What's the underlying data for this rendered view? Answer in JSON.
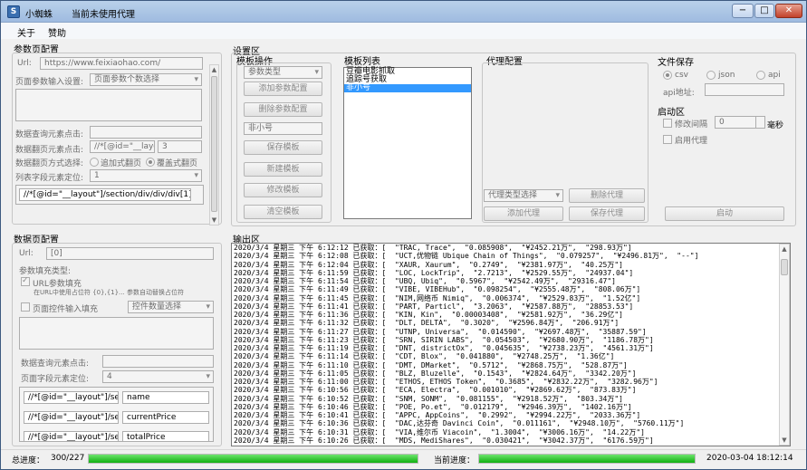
{
  "window": {
    "title": "小蜘蛛",
    "status": "当前未使用代理",
    "icon": "spider-app-icon",
    "controls": {
      "min": "−",
      "max": "□",
      "close": "✕"
    }
  },
  "menu": [
    {
      "label": "关于"
    },
    {
      "label": "赞助"
    }
  ],
  "param_config": {
    "title": "参数页配置",
    "url_label": "Url:",
    "url_value": "https://www.feixiaohao.com/",
    "page_param_label": "页面参数输入设置:",
    "page_param_select": "页面参数个数选择",
    "query_click_label": "数据查询元素点击:",
    "page_click_label": "数据翻页元素点击:",
    "page_click_value": "//*[@id=\"__layo",
    "page_click_count": "3",
    "page_mode_label": "数据翻页方式选择:",
    "page_mode_options": [
      "追加式翻页",
      "覆盖式翻页"
    ],
    "list_locate_label": "列表字段元素定位:",
    "list_locate_value": "1",
    "xpath_value": "//*[@id=\"__layout\"]/section/div/div/div[1]"
  },
  "data_config": {
    "title": "数据页配置",
    "url_label": "Url:",
    "url_value": "[0]",
    "param_type_label": "参数填充类型:",
    "url_fill_label": "URL参数填充",
    "url_fill_hint": "在URL中使用占位符 {0},{1}... 参数自动替换占位符",
    "ctrl_fill_label": "页面控件输入填充",
    "ctrl_count_select": "控件数量选择",
    "query_click_label": "数据查询元素点击:",
    "field_locate_label": "页面字段元素定位:",
    "field_locate_value": "4",
    "fields": [
      {
        "xpath": "//*[@id=\"__layout\"]/sec",
        "name": "name"
      },
      {
        "xpath": "//*[@id=\"__layout\"]/sec",
        "name": "currentPrice"
      },
      {
        "xpath": "//*[@id=\"__layout\"]/sec",
        "name": "totalPrice"
      }
    ]
  },
  "settings": {
    "title": "设置区",
    "template_ops": {
      "title": "模板操作",
      "param_type_select": "参数类型",
      "add_param": "添加参数配置",
      "delete_param": "删除参数配置",
      "template_name": "非小号",
      "save_template": "保存模板",
      "new_template": "新建模板",
      "edit_template": "修改模板",
      "clear_template": "清空模板"
    },
    "template_list": {
      "title": "模板列表",
      "items": [
        "豆瓣电影抓取",
        "追踪号获取",
        "非小号"
      ],
      "selected_index": 2
    },
    "proxy": {
      "title": "代理配置",
      "type_select": "代理类型选择",
      "delete_proxy": "删除代理",
      "add_proxy": "添加代理",
      "save_proxy": "保存代理"
    },
    "file_save": {
      "title": "文件保存",
      "options": [
        "csv",
        "json",
        "api"
      ],
      "api_label": "api地址:"
    },
    "start_area": {
      "title": "启动区",
      "interval_label": "修改间隔",
      "interval_value": "0",
      "interval_unit": "毫秒",
      "use_proxy_label": "启用代理",
      "start_button": "启动"
    }
  },
  "output": {
    "title": "输出区",
    "lines": [
      "2020/3/4 星期三 下午 6:12:12 已获取：[  \"TRAC, Trace\",  \"0.085908\",  \"¥2452.21万\",  \"298.93万\"]",
      "2020/3/4 星期三 下午 6:12:08 已获取：[  \"UCT,优物链 Ubique Chain of Things\",  \"0.079257\",  \"¥2496.81万\",  \"--\"]",
      "2020/3/4 星期三 下午 6:12:04 已获取：[  \"XAUR, Xaurum\",  \"0.2749\",  \"¥2381.97万\",  \"40.25万\"]",
      "2020/3/4 星期三 下午 6:11:59 已获取：[  \"LOC, LockTrip\",  \"2.7213\",  \"¥2529.55万\",  \"24937.04\"]",
      "2020/3/4 星期三 下午 6:11:54 已获取：[  \"UBQ, Ubiq\",  \"0.5967\",  \"¥2542.49万\",  \"29316.47\"]",
      "2020/3/4 星期三 下午 6:11:49 已获取：[  \"VIBE, VIBEHub\",  \"0.098254\",  \"¥2555.48万\",  \"808.06万\"]",
      "2020/3/4 星期三 下午 6:11:45 已获取：[  \"NIM,网络币 Nimiq\",  \"0.006374\",  \"¥2529.83万\",  \"1.52亿\"]",
      "2020/3/4 星期三 下午 6:11:41 已获取：[  \"PART, Particl\",  \"3.2063\",  \"¥2587.88万\",  \"28853.53\"]",
      "2020/3/4 星期三 下午 6:11:36 已获取：[  \"KIN, Kin\",  \"0.00003408\",  \"¥2581.92万\",  \"36.29亿\"]",
      "2020/3/4 星期三 下午 6:11:32 已获取：[  \"DLT, DELTA\",  \"0.3020\",  \"¥2596.84万\",  \"206.91万\"]",
      "2020/3/4 星期三 下午 6:11:27 已获取：[  \"UTNP, Universa\",  \"0.014590\",  \"¥2697.48万\",  \"35887.59\"]",
      "2020/3/4 星期三 下午 6:11:23 已获取：[  \"SRN, SIRIN LABS\",  \"0.054503\",  \"¥2680.90万\",  \"1186.78万\"]",
      "2020/3/4 星期三 下午 6:11:19 已获取：[  \"DNT, districtOx\",  \"0.045635\",  \"¥2738.23万\",  \"4561.31万\"]",
      "2020/3/4 星期三 下午 6:11:14 已获取：[  \"CDT, Blox\",  \"0.041880\",  \"¥2748.25万\",  \"1.36亿\"]",
      "2020/3/4 星期三 下午 6:11:10 已获取：[  \"DMT, DMarket\",  \"0.5712\",  \"¥2868.75万\",  \"528.87万\"]",
      "2020/3/4 星期三 下午 6:11:05 已获取：[  \"BLZ, Bluzelle\",  \"0.1543\",  \"¥2824.64万\",  \"3342.20万\"]",
      "2020/3/4 星期三 下午 6:11:00 已获取：[  \"ETHOS, ETHOS Token\",  \"0.3685\",  \"¥2832.22万\",  \"3282.96万\"]",
      "2020/3/4 星期三 下午 6:10:56 已获取：[  \"ECA, Electra\",  \"0.001010\",  \"¥2869.62万\",  \"873.83万\"]",
      "2020/3/4 星期三 下午 6:10:52 已获取：[  \"SNM, SONM\",  \"0.081155\",  \"¥2918.52万\",  \"803.34万\"]",
      "2020/3/4 星期三 下午 6:10:46 已获取：[  \"POE, Po.et\",  \"0.012179\",  \"¥2946.39万\",  \"1402.16万\"]",
      "2020/3/4 星期三 下午 6:10:41 已获取：[  \"APPC, AppCoins\",  \"0.2992\",  \"¥2994.22万\",  \"2033.36万\"]",
      "2020/3/4 星期三 下午 6:10:36 已获取：[  \"DAC,达芬奇 Davinci Coin\",  \"0.011161\",  \"¥2948.10万\",  \"5760.11万\"]",
      "2020/3/4 星期三 下午 6:10:31 已获取：[  \"VIA,维尔币 Viacoin\",  \"1.3004\",  \"¥3006.16万\",  \"14.22万\"]",
      "2020/3/4 星期三 下午 6:10:26 已获取：[  \"MDS, MediShares\",  \"0.030421\",  \"¥3042.37万\",  \"6176.59万\"]"
    ]
  },
  "status": {
    "total_label": "总进度：",
    "total_value": "300/227",
    "total_progress": 1.0,
    "current_label": "当前进度：",
    "current_progress": 1.0,
    "datetime": "2020-03-04 18:12:14"
  }
}
